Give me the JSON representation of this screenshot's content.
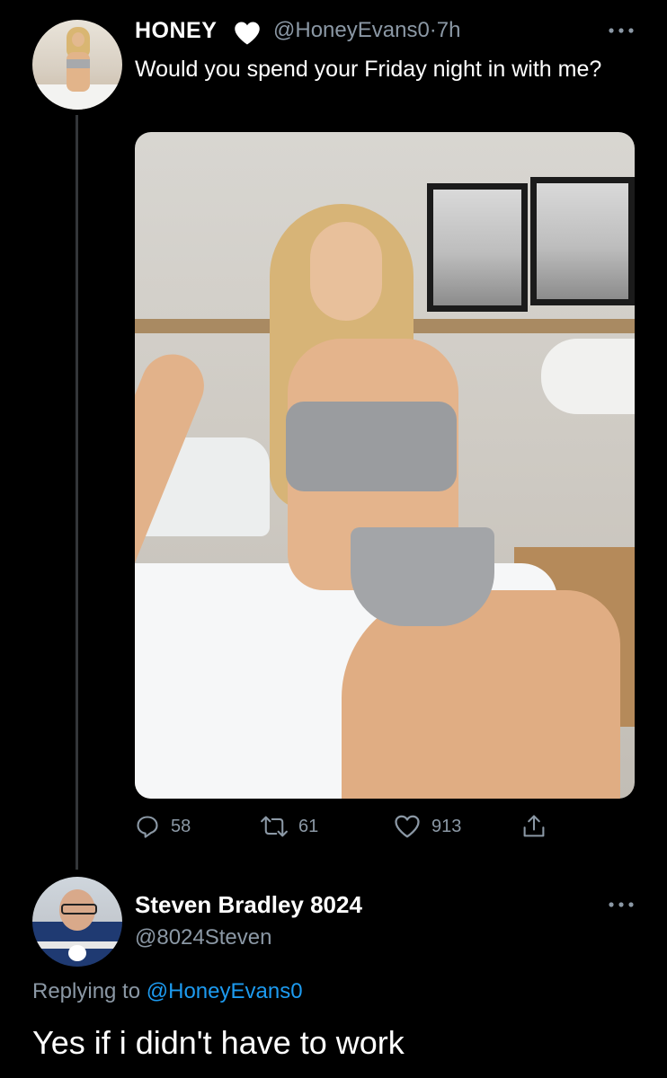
{
  "tweet": {
    "author_name": "HONEY",
    "handle": "@HoneyEvans0",
    "separator": "·",
    "time": "7h",
    "text": "Would you spend your Friday night in with me?",
    "stats": {
      "replies": "58",
      "retweets": "61",
      "likes": "913"
    }
  },
  "reply": {
    "author_name": "Steven Bradley 8024",
    "handle": "@8024Steven",
    "replying_prefix": "Replying to",
    "replying_to": "@HoneyEvans0",
    "text": "Yes if i didn't have to work"
  },
  "colors": {
    "background": "#000000",
    "primary_text": "#ffffff",
    "secondary_text": "#8b98a5",
    "link": "#1d9bf0",
    "thread_line": "#333639"
  },
  "icons": {
    "verified_like": "heart-icon",
    "more": "more-icon",
    "reply": "reply-icon",
    "retweet": "retweet-icon",
    "like": "like-icon",
    "share": "share-icon"
  }
}
